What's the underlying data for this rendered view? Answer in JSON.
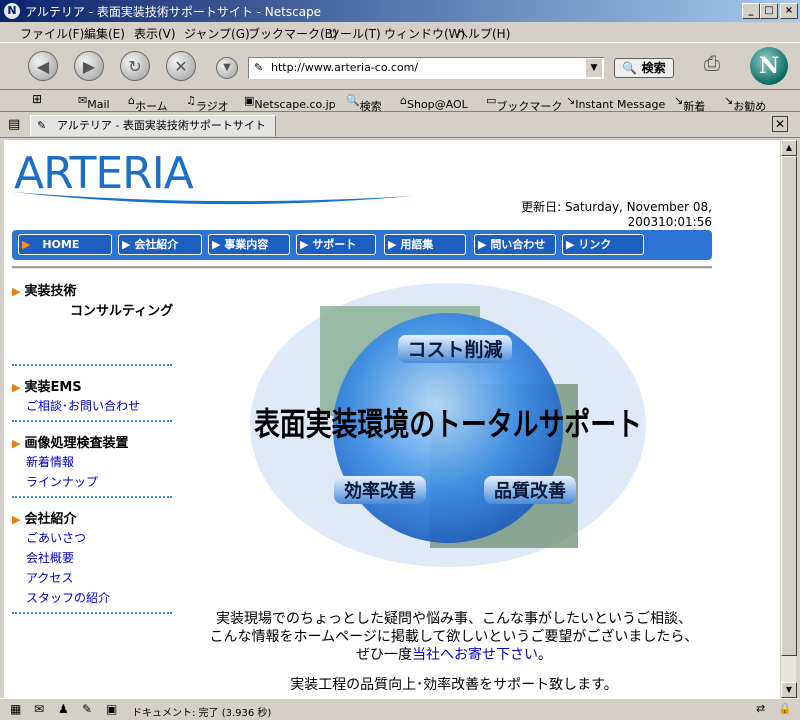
{
  "window": {
    "title": "アルテリア - 表面実装技術サポートサイト - Netscape",
    "app_icon": "N"
  },
  "menu": [
    "ファイル(F)",
    "編集(E)",
    "表示(V)",
    "ジャンプ(G)",
    "ブックマーク(B)",
    "ツール(T)",
    "ウィンドウ(W)",
    "ヘルプ(H)"
  ],
  "toolbar": {
    "url": "http://www.arteria-co.com/",
    "search_label": "検索",
    "netscape_logo": "N"
  },
  "personal_toolbar": [
    "Mail",
    "ホーム",
    "ラジオ",
    "Netscape.co.jp",
    "検索",
    "Shop@AOL",
    "ブックマーク",
    "Instant Message",
    "新着",
    "お勧め"
  ],
  "tab": {
    "label": "アルテリア - 表面実装技術サポートサイト"
  },
  "page": {
    "logo": "ARTERIA",
    "updated_line1": "更新日: Saturday, November 08,",
    "updated_line2": "200310:01:56",
    "nav": [
      "HOME",
      "会社紹介",
      "事業内容",
      "サポート",
      "用語集",
      "問い合わせ",
      "リンク"
    ],
    "sidebar": {
      "tech_title": "実装技術",
      "tech_sub": "コンサルティング",
      "ems_title": "実装EMS",
      "ems_link": "ご相談･お問い合わせ",
      "vision_title": "画像処理検査装置",
      "vision_links": [
        "新着情報",
        "ラインナップ"
      ],
      "company_title": "会社紹介",
      "company_links": [
        "ごあいさつ",
        "会社概要",
        "アクセス",
        "スタッフの紹介"
      ]
    },
    "hero": {
      "main": "表面実装環境のトータルサポート",
      "tag1": "コスト削減",
      "tag2": "効率改善",
      "tag3": "品質改善"
    },
    "intro_line1": "実装現場でのちょっとした疑問や悩み事、こんな事がしたいというご相談、",
    "intro_line2": "こんな情報をホームページに掲載して欲しいというご要望がございましたら、",
    "intro_line3_pre": "ぜひ一度",
    "intro_line3_link": "当社へお寄せ下さい",
    "intro_line3_post": "。",
    "intro_line4": "実装工程の品質向上･効率改善をサポート致します。"
  },
  "status": {
    "text": "ドキュメント: 完了 (3.936 秒)"
  },
  "colors": {
    "brand_blue": "#1b6fc6",
    "nav_blue": "#2d73d4",
    "accent_orange": "#f07d00"
  }
}
